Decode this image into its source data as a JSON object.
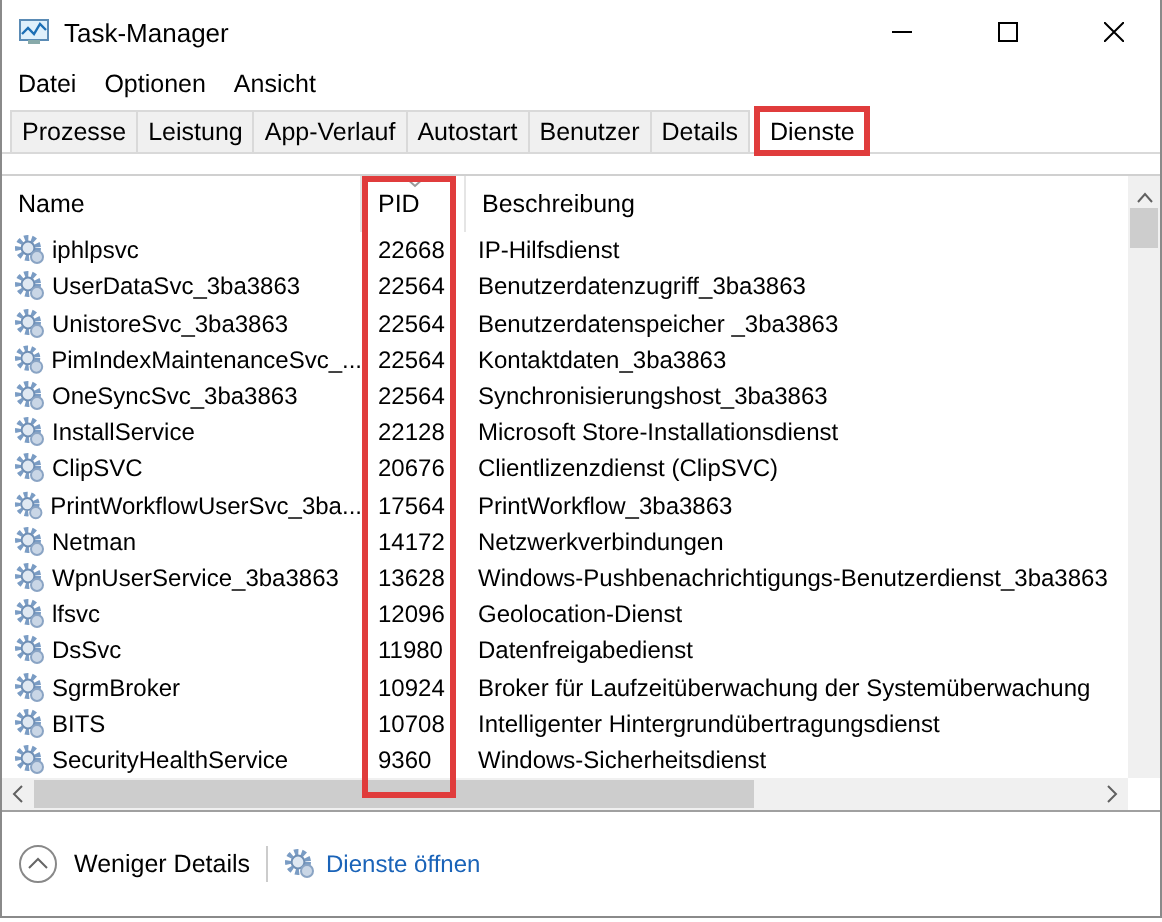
{
  "window": {
    "title": "Task-Manager"
  },
  "menu": [
    "Datei",
    "Optionen",
    "Ansicht"
  ],
  "tabs": [
    {
      "label": "Prozesse",
      "selected": false,
      "highlighted": false
    },
    {
      "label": "Leistung",
      "selected": false,
      "highlighted": false
    },
    {
      "label": "App-Verlauf",
      "selected": false,
      "highlighted": false
    },
    {
      "label": "Autostart",
      "selected": false,
      "highlighted": false
    },
    {
      "label": "Benutzer",
      "selected": false,
      "highlighted": false
    },
    {
      "label": "Details",
      "selected": false,
      "highlighted": false
    },
    {
      "label": "Dienste",
      "selected": true,
      "highlighted": true
    }
  ],
  "table": {
    "columns": [
      {
        "label": "Name",
        "sorted": false,
        "highlighted": false
      },
      {
        "label": "PID",
        "sorted": true,
        "highlighted": true
      },
      {
        "label": "Beschreibung",
        "sorted": false,
        "highlighted": false
      }
    ],
    "rows": [
      [
        "iphlpsvc",
        "22668",
        "IP-Hilfsdienst"
      ],
      [
        "UserDataSvc_3ba3863",
        "22564",
        "Benutzerdatenzugriff_3ba3863"
      ],
      [
        "UnistoreSvc_3ba3863",
        "22564",
        "Benutzerdatenspeicher _3ba3863"
      ],
      [
        "PimIndexMaintenanceSvc_...",
        "22564",
        "Kontaktdaten_3ba3863"
      ],
      [
        "OneSyncSvc_3ba3863",
        "22564",
        "Synchronisierungshost_3ba3863"
      ],
      [
        "InstallService",
        "22128",
        "Microsoft Store-Installationsdienst"
      ],
      [
        "ClipSVC",
        "20676",
        "Clientlizenzdienst (ClipSVC)"
      ],
      [
        "PrintWorkflowUserSvc_3ba...",
        "17564",
        "PrintWorkflow_3ba3863"
      ],
      [
        "Netman",
        "14172",
        "Netzwerkverbindungen"
      ],
      [
        "WpnUserService_3ba3863",
        "13628",
        "Windows-Pushbenachrichtigungs-Benutzerdienst_3ba3863"
      ],
      [
        "lfsvc",
        "12096",
        "Geolocation-Dienst"
      ],
      [
        "DsSvc",
        "11980",
        "Datenfreigabedienst"
      ],
      [
        "SgrmBroker",
        "10924",
        "Broker für Laufzeitüberwachung der Systemüberwachung"
      ],
      [
        "BITS",
        "10708",
        "Intelligenter Hintergrundübertragungsdienst"
      ],
      [
        "SecurityHealthService",
        "9360",
        "Windows-Sicherheitsdienst"
      ]
    ]
  },
  "footer": {
    "less_details": "Weniger Details",
    "open_services": "Dienste öffnen"
  }
}
